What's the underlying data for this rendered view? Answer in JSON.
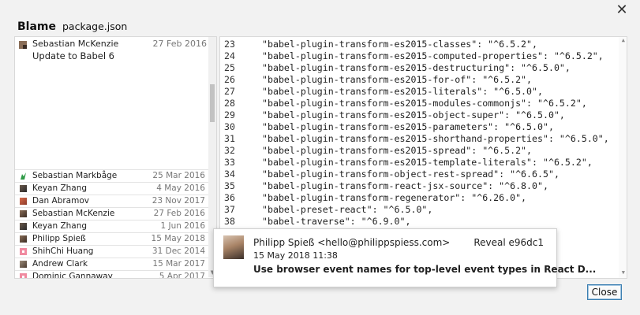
{
  "window": {
    "close_glyph": "✕",
    "title": "Blame",
    "file": "package.json"
  },
  "blame": {
    "first_commit": {
      "author": "Sebastian McKenzie",
      "date": "27 Feb 2016",
      "message": "Update to Babel 6"
    },
    "rows": [
      {
        "author": "Sebastian Markbåge",
        "date": "25 Mar 2016"
      },
      {
        "author": "Keyan Zhang",
        "date": "4 May 2016"
      },
      {
        "author": "Dan Abramov",
        "date": "23 Nov 2017"
      },
      {
        "author": "Sebastian McKenzie",
        "date": "27 Feb 2016"
      },
      {
        "author": "Keyan Zhang",
        "date": "1 Jun 2016"
      },
      {
        "author": "Philipp Spieß",
        "date": "15 May 2018"
      },
      {
        "author": "ShihChi Huang",
        "date": "31 Dec 2014"
      },
      {
        "author": "Andrew Clark",
        "date": "15 Mar 2017"
      },
      {
        "author": "Dominic Gannaway",
        "date": "5 Apr 2017"
      }
    ]
  },
  "code": {
    "lines": [
      {
        "num": "23",
        "text": "\"babel-plugin-transform-es2015-classes\": \"^6.5.2\","
      },
      {
        "num": "24",
        "text": "\"babel-plugin-transform-es2015-computed-properties\": \"^6.5.2\","
      },
      {
        "num": "25",
        "text": "\"babel-plugin-transform-es2015-destructuring\": \"^6.5.0\","
      },
      {
        "num": "26",
        "text": "\"babel-plugin-transform-es2015-for-of\": \"^6.5.2\","
      },
      {
        "num": "27",
        "text": "\"babel-plugin-transform-es2015-literals\": \"^6.5.0\","
      },
      {
        "num": "28",
        "text": "\"babel-plugin-transform-es2015-modules-commonjs\": \"^6.5.2\","
      },
      {
        "num": "29",
        "text": "\"babel-plugin-transform-es2015-object-super\": \"^6.5.0\","
      },
      {
        "num": "30",
        "text": "\"babel-plugin-transform-es2015-parameters\": \"^6.5.0\","
      },
      {
        "num": "31",
        "text": "\"babel-plugin-transform-es2015-shorthand-properties\": \"^6.5.0\","
      },
      {
        "num": "32",
        "text": "\"babel-plugin-transform-es2015-spread\": \"^6.5.2\","
      },
      {
        "num": "33",
        "text": "\"babel-plugin-transform-es2015-template-literals\": \"^6.5.2\","
      },
      {
        "num": "34",
        "text": "\"babel-plugin-transform-object-rest-spread\": \"^6.6.5\","
      },
      {
        "num": "35",
        "text": "\"babel-plugin-transform-react-jsx-source\": \"^6.8.0\","
      },
      {
        "num": "36",
        "text": "\"babel-plugin-transform-regenerator\": \"^6.26.0\","
      },
      {
        "num": "37",
        "text": "\"babel-preset-react\": \"^6.5.0\","
      },
      {
        "num": "38",
        "text": "\"babel-traverse\": \"^6.9.0\","
      }
    ]
  },
  "tooltip": {
    "author": "Philipp Spieß <hello@philippspiess.com>",
    "reveal": "Reveal e96dc1",
    "when": "15 May 2018 11:38",
    "subject": "Use browser event names for top-level event types in React D..."
  },
  "footer": {
    "close_label": "Close"
  }
}
